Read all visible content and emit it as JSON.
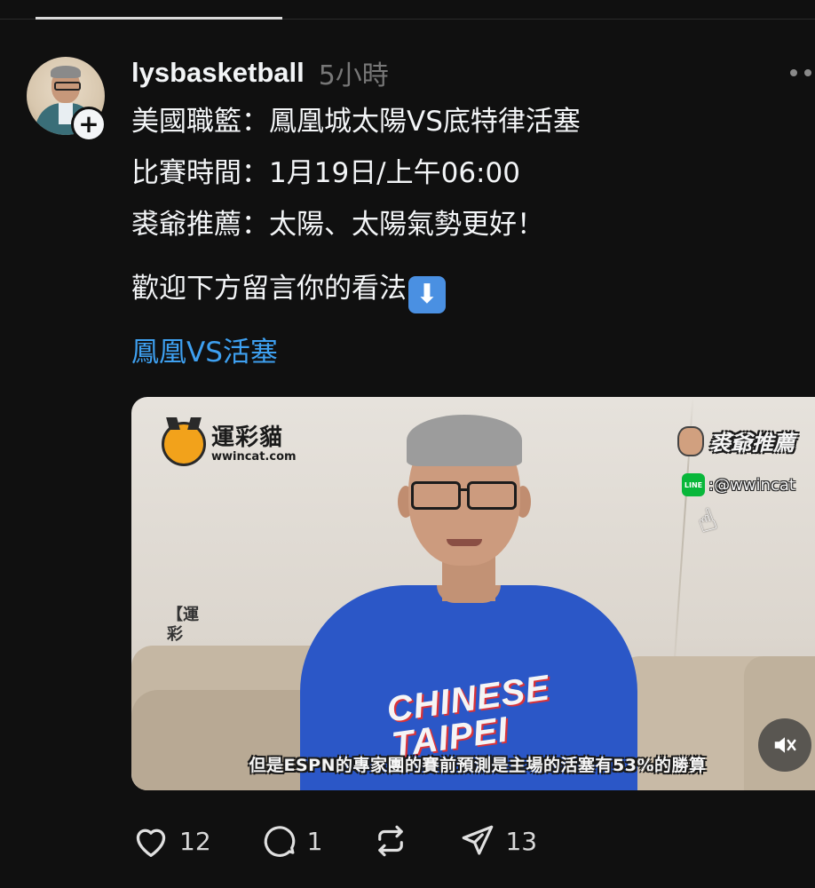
{
  "post": {
    "username": "lysbasketball",
    "time": "5小時",
    "lines": [
      "美國職籃：鳳凰城太陽VS底特律活塞",
      "比賽時間：1月19日/上午06:00",
      "裘爺推薦：太陽、太陽氣勢更好！"
    ],
    "prompt": "歡迎下方留言你的看法",
    "link_text": "鳳凰VS活塞"
  },
  "video": {
    "logo_name": "運彩貓",
    "logo_url": "wwincat.com",
    "side_text": "【運彩",
    "reco_title": "裘爺推薦",
    "line_icon_label": "LINE",
    "line_id": ":@wwincat",
    "shirt_text_1": "CHINESE",
    "shirt_text_2": "TAIPEI",
    "subtitle": "但是ESPN的專家團的賽前預測是主場的活塞有53%的勝算"
  },
  "actions": {
    "likes": "12",
    "replies": "1",
    "shares": "13"
  },
  "colors": {
    "background": "#101010",
    "link": "#3ea0f0",
    "muted_text": "#777777"
  }
}
